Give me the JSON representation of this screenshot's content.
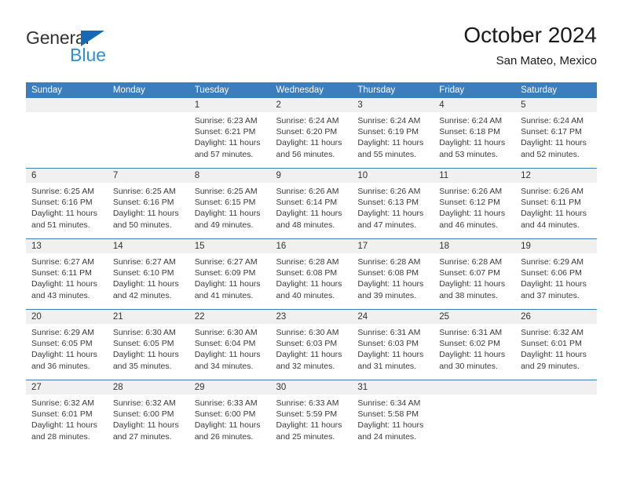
{
  "brand": {
    "line1": "General",
    "line2": "Blue",
    "triangle_color": "#1669b4",
    "line2_color": "#2d8fd5"
  },
  "header": {
    "title": "October 2024",
    "subtitle": "San Mateo, Mexico"
  },
  "theme": {
    "header_blue": "#3b7dbd",
    "daynum_gray": "#f0f0f0",
    "text_color": "#3a3a3a"
  },
  "calendar": {
    "weekday_headers": [
      "Sunday",
      "Monday",
      "Tuesday",
      "Wednesday",
      "Thursday",
      "Friday",
      "Saturday"
    ],
    "weeks": [
      [
        {
          "day": "",
          "lines": []
        },
        {
          "day": "",
          "lines": []
        },
        {
          "day": "1",
          "lines": [
            "Sunrise: 6:23 AM",
            "Sunset: 6:21 PM",
            "Daylight: 11 hours",
            "and 57 minutes."
          ]
        },
        {
          "day": "2",
          "lines": [
            "Sunrise: 6:24 AM",
            "Sunset: 6:20 PM",
            "Daylight: 11 hours",
            "and 56 minutes."
          ]
        },
        {
          "day": "3",
          "lines": [
            "Sunrise: 6:24 AM",
            "Sunset: 6:19 PM",
            "Daylight: 11 hours",
            "and 55 minutes."
          ]
        },
        {
          "day": "4",
          "lines": [
            "Sunrise: 6:24 AM",
            "Sunset: 6:18 PM",
            "Daylight: 11 hours",
            "and 53 minutes."
          ]
        },
        {
          "day": "5",
          "lines": [
            "Sunrise: 6:24 AM",
            "Sunset: 6:17 PM",
            "Daylight: 11 hours",
            "and 52 minutes."
          ]
        }
      ],
      [
        {
          "day": "6",
          "lines": [
            "Sunrise: 6:25 AM",
            "Sunset: 6:16 PM",
            "Daylight: 11 hours",
            "and 51 minutes."
          ]
        },
        {
          "day": "7",
          "lines": [
            "Sunrise: 6:25 AM",
            "Sunset: 6:16 PM",
            "Daylight: 11 hours",
            "and 50 minutes."
          ]
        },
        {
          "day": "8",
          "lines": [
            "Sunrise: 6:25 AM",
            "Sunset: 6:15 PM",
            "Daylight: 11 hours",
            "and 49 minutes."
          ]
        },
        {
          "day": "9",
          "lines": [
            "Sunrise: 6:26 AM",
            "Sunset: 6:14 PM",
            "Daylight: 11 hours",
            "and 48 minutes."
          ]
        },
        {
          "day": "10",
          "lines": [
            "Sunrise: 6:26 AM",
            "Sunset: 6:13 PM",
            "Daylight: 11 hours",
            "and 47 minutes."
          ]
        },
        {
          "day": "11",
          "lines": [
            "Sunrise: 6:26 AM",
            "Sunset: 6:12 PM",
            "Daylight: 11 hours",
            "and 46 minutes."
          ]
        },
        {
          "day": "12",
          "lines": [
            "Sunrise: 6:26 AM",
            "Sunset: 6:11 PM",
            "Daylight: 11 hours",
            "and 44 minutes."
          ]
        }
      ],
      [
        {
          "day": "13",
          "lines": [
            "Sunrise: 6:27 AM",
            "Sunset: 6:11 PM",
            "Daylight: 11 hours",
            "and 43 minutes."
          ]
        },
        {
          "day": "14",
          "lines": [
            "Sunrise: 6:27 AM",
            "Sunset: 6:10 PM",
            "Daylight: 11 hours",
            "and 42 minutes."
          ]
        },
        {
          "day": "15",
          "lines": [
            "Sunrise: 6:27 AM",
            "Sunset: 6:09 PM",
            "Daylight: 11 hours",
            "and 41 minutes."
          ]
        },
        {
          "day": "16",
          "lines": [
            "Sunrise: 6:28 AM",
            "Sunset: 6:08 PM",
            "Daylight: 11 hours",
            "and 40 minutes."
          ]
        },
        {
          "day": "17",
          "lines": [
            "Sunrise: 6:28 AM",
            "Sunset: 6:08 PM",
            "Daylight: 11 hours",
            "and 39 minutes."
          ]
        },
        {
          "day": "18",
          "lines": [
            "Sunrise: 6:28 AM",
            "Sunset: 6:07 PM",
            "Daylight: 11 hours",
            "and 38 minutes."
          ]
        },
        {
          "day": "19",
          "lines": [
            "Sunrise: 6:29 AM",
            "Sunset: 6:06 PM",
            "Daylight: 11 hours",
            "and 37 minutes."
          ]
        }
      ],
      [
        {
          "day": "20",
          "lines": [
            "Sunrise: 6:29 AM",
            "Sunset: 6:05 PM",
            "Daylight: 11 hours",
            "and 36 minutes."
          ]
        },
        {
          "day": "21",
          "lines": [
            "Sunrise: 6:30 AM",
            "Sunset: 6:05 PM",
            "Daylight: 11 hours",
            "and 35 minutes."
          ]
        },
        {
          "day": "22",
          "lines": [
            "Sunrise: 6:30 AM",
            "Sunset: 6:04 PM",
            "Daylight: 11 hours",
            "and 34 minutes."
          ]
        },
        {
          "day": "23",
          "lines": [
            "Sunrise: 6:30 AM",
            "Sunset: 6:03 PM",
            "Daylight: 11 hours",
            "and 32 minutes."
          ]
        },
        {
          "day": "24",
          "lines": [
            "Sunrise: 6:31 AM",
            "Sunset: 6:03 PM",
            "Daylight: 11 hours",
            "and 31 minutes."
          ]
        },
        {
          "day": "25",
          "lines": [
            "Sunrise: 6:31 AM",
            "Sunset: 6:02 PM",
            "Daylight: 11 hours",
            "and 30 minutes."
          ]
        },
        {
          "day": "26",
          "lines": [
            "Sunrise: 6:32 AM",
            "Sunset: 6:01 PM",
            "Daylight: 11 hours",
            "and 29 minutes."
          ]
        }
      ],
      [
        {
          "day": "27",
          "lines": [
            "Sunrise: 6:32 AM",
            "Sunset: 6:01 PM",
            "Daylight: 11 hours",
            "and 28 minutes."
          ]
        },
        {
          "day": "28",
          "lines": [
            "Sunrise: 6:32 AM",
            "Sunset: 6:00 PM",
            "Daylight: 11 hours",
            "and 27 minutes."
          ]
        },
        {
          "day": "29",
          "lines": [
            "Sunrise: 6:33 AM",
            "Sunset: 6:00 PM",
            "Daylight: 11 hours",
            "and 26 minutes."
          ]
        },
        {
          "day": "30",
          "lines": [
            "Sunrise: 6:33 AM",
            "Sunset: 5:59 PM",
            "Daylight: 11 hours",
            "and 25 minutes."
          ]
        },
        {
          "day": "31",
          "lines": [
            "Sunrise: 6:34 AM",
            "Sunset: 5:58 PM",
            "Daylight: 11 hours",
            "and 24 minutes."
          ]
        },
        {
          "day": "",
          "lines": []
        },
        {
          "day": "",
          "lines": []
        }
      ]
    ]
  }
}
